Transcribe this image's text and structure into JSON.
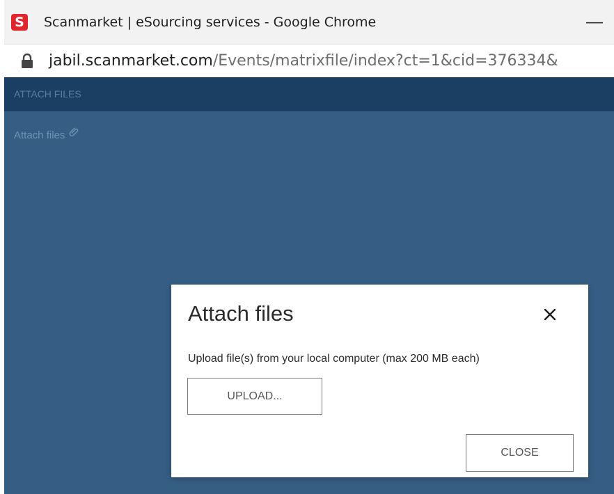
{
  "browser": {
    "app_icon_letter": "S",
    "window_title": "Scanmarket | eSourcing services - Google Chrome",
    "minimize_symbol": "—",
    "url_domain": "jabil.scanmarket.com",
    "url_path": "/Events/matrixfile/index?ct=1&cid=376334&",
    "icons": {
      "app": "scanmarket-logo-icon",
      "lock": "lock-icon"
    }
  },
  "page": {
    "header_title": "ATTACH FILES",
    "attach_link_label": "Attach files",
    "attach_icon": "paperclip-icon"
  },
  "dialog": {
    "title": "Attach files",
    "close_icon": "close-icon",
    "description": "Upload file(s) from your local computer (max 200 MB each)",
    "upload_button_label": "UPLOAD...",
    "close_button_label": "CLOSE"
  },
  "colors": {
    "logo_red": "#e0262c",
    "page_background": "#365d83",
    "header_background": "#1a3f62",
    "dialog_background": "#ffffff"
  }
}
